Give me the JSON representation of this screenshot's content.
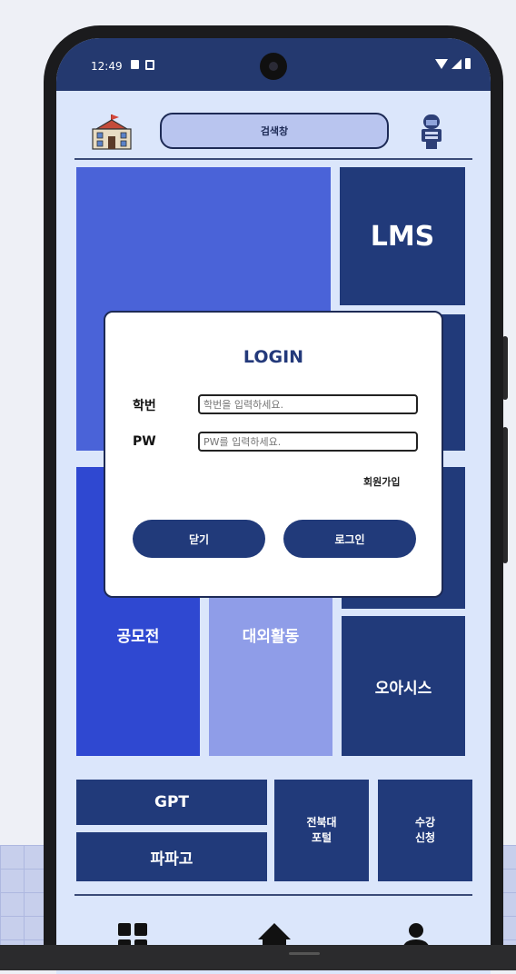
{
  "status": {
    "time": "12:49"
  },
  "header": {
    "search_label": "검색창"
  },
  "tiles": {
    "banner": "",
    "lms": "LMS",
    "contest": "공모전",
    "activities": "대외활동",
    "oasis": "오아시스",
    "gpt": "GPT",
    "papago": "파파고",
    "portal": "전북대\n포털",
    "registration": "수강\n신청"
  },
  "login": {
    "title": "LOGIN",
    "id_label": "학번",
    "id_placeholder": "학번을 입력하세요.",
    "pw_label": "PW",
    "pw_placeholder": "PW를 입력하세요.",
    "signup": "회원가입",
    "close_button": "닫기",
    "login_button": "로그인"
  },
  "icons": {
    "school": "school-icon",
    "robot": "robot-icon",
    "grid": "grid-icon",
    "home": "home-icon",
    "profile": "person-icon"
  },
  "colors": {
    "navy": "#213a7a",
    "royal": "#4a63d8",
    "blue": "#2f48d1",
    "light": "#8f9de8",
    "background": "#dbe6fb"
  }
}
